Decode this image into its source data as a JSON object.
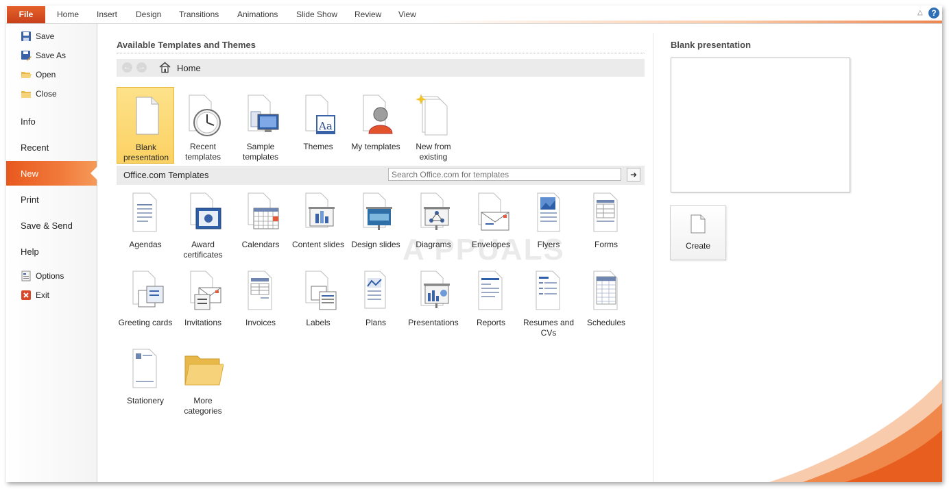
{
  "ribbon": {
    "file_tab": "File",
    "tabs": [
      "Home",
      "Insert",
      "Design",
      "Transitions",
      "Animations",
      "Slide Show",
      "Review",
      "View"
    ],
    "help": "?",
    "minimize": "△"
  },
  "sidebar": {
    "small_top": [
      {
        "label": "Save",
        "icon": "save-icon"
      },
      {
        "label": "Save As",
        "icon": "save-as-icon"
      },
      {
        "label": "Open",
        "icon": "open-folder-icon"
      },
      {
        "label": "Close",
        "icon": "close-folder-icon"
      }
    ],
    "big": [
      {
        "label": "Info"
      },
      {
        "label": "Recent"
      },
      {
        "label": "New",
        "active": true
      },
      {
        "label": "Print"
      },
      {
        "label": "Save & Send"
      },
      {
        "label": "Help"
      }
    ],
    "small_bottom": [
      {
        "label": "Options",
        "icon": "options-icon"
      },
      {
        "label": "Exit",
        "icon": "exit-icon"
      }
    ]
  },
  "main": {
    "title": "Available Templates and Themes",
    "nav": {
      "back": "←",
      "forward": "→",
      "home_label": "Home"
    },
    "top_tiles": [
      {
        "label": "Blank presentation",
        "icon": "blank-page-icon",
        "selected": true
      },
      {
        "label": "Recent templates",
        "icon": "clock-icon"
      },
      {
        "label": "Sample templates",
        "icon": "monitor-icon"
      },
      {
        "label": "Themes",
        "icon": "themes-aa-icon"
      },
      {
        "label": "My templates",
        "icon": "person-icon"
      },
      {
        "label": "New from existing",
        "icon": "sparkle-page-icon"
      }
    ],
    "office_com": {
      "label": "Office.com Templates",
      "search_placeholder": "Search Office.com for templates",
      "go": "➜"
    },
    "categories": [
      {
        "label": "Agendas",
        "icon": "agenda-icon"
      },
      {
        "label": "Award certificates",
        "icon": "certificate-icon"
      },
      {
        "label": "Calendars",
        "icon": "calendar-icon"
      },
      {
        "label": "Content slides",
        "icon": "content-slide-icon"
      },
      {
        "label": "Design slides",
        "icon": "design-slide-icon"
      },
      {
        "label": "Diagrams",
        "icon": "diagram-icon"
      },
      {
        "label": "Envelopes",
        "icon": "envelope-icon"
      },
      {
        "label": "Flyers",
        "icon": "flyer-icon"
      },
      {
        "label": "Forms",
        "icon": "form-icon"
      },
      {
        "label": "Greeting cards",
        "icon": "greeting-card-icon"
      },
      {
        "label": "Invitations",
        "icon": "invitation-icon"
      },
      {
        "label": "Invoices",
        "icon": "invoice-icon"
      },
      {
        "label": "Labels",
        "icon": "label-icon"
      },
      {
        "label": "Plans",
        "icon": "plan-icon"
      },
      {
        "label": "Presentations",
        "icon": "presentation-icon"
      },
      {
        "label": "Reports",
        "icon": "report-icon"
      },
      {
        "label": "Resumes and CVs",
        "icon": "resume-icon"
      },
      {
        "label": "Schedules",
        "icon": "schedule-icon"
      },
      {
        "label": "Stationery",
        "icon": "stationery-icon"
      },
      {
        "label": "More categories",
        "icon": "folder-icon"
      }
    ],
    "watermark": "A PPUALS"
  },
  "right_pane": {
    "title": "Blank presentation",
    "create_label": "Create"
  },
  "colors": {
    "accent": "#e8581e",
    "selected_tile": "#fbd163",
    "bar_bg": "#ebebeb"
  }
}
